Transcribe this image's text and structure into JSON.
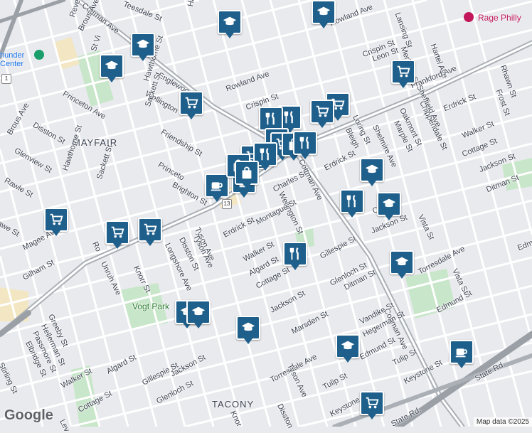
{
  "neighborhoods": {
    "mayfair": "MAYFAIR",
    "tacony": "TACONY"
  },
  "parks": {
    "vogt_park": "Vogt Park"
  },
  "places": {
    "rage_philly": "Rage Philly",
    "thunder_center_line1": "hunder",
    "thunder_center_line2": "Center"
  },
  "route_shield": "13",
  "route_shield_left": "1",
  "streets": {
    "teesdale": "Teesdale St",
    "cottman_top": "Cottman Ave",
    "hawthorne_top": "Hawthorne St",
    "revere": "Revere St",
    "brous_top": "Brous Ave",
    "st_vi": "St Vi",
    "rowland_top": "Rowland Ave",
    "crispin_top": "Crispin St",
    "lansing": "Lansing St",
    "meridian": "Meridian St",
    "hartel": "Hartel Ave",
    "leon": "Leon St",
    "englewood": "Englewood",
    "hawthorne_mid": "Hawthorne St",
    "wellington_top": "Wellington",
    "rowland_mid": "Rowland Ave",
    "crispin_mid": "Crispin St",
    "frankford": "Frankford Ave",
    "rhawn": "Rhawn St",
    "frost": "Frost St",
    "princeton_left": "Princeton Ave",
    "sackett_top": "Sackett St",
    "friendship": "Friendship St",
    "disston_left": "Disston St",
    "brous_left": "Brous Ave",
    "glenview": "Glenview St",
    "hawthorne_left": "Hawthorne St",
    "sackett_left": "Sackett St",
    "rawle": "Rawle St",
    "awe": "awe St",
    "princeton_mid": "Princeto",
    "brighton": "Brighton St",
    "charles": "Charles St",
    "wellington_mid": "Wellington St",
    "erdrick_mid": "Erdrick St",
    "cottman_mid": "Cottman Ave",
    "loring": "Loring St",
    "bleigh": "Bleigh",
    "shelmire": "Shelmire Ave",
    "oakmont": "Oakmont St",
    "marple": "Marple St",
    "chippendale": "Chippendale St",
    "sheffield": "Sheffield Ave",
    "erdrick_right": "Erdrick St",
    "walker_right": "Walker St",
    "cottage_right": "Cottage St",
    "jackson_right": "Jackson St",
    "ditman_right": "Ditman St",
    "cottage_mid": "Cottage",
    "jackson_mid": "Jackson St",
    "vista_mid": "Vista St",
    "edmun": "Edmun",
    "erdrick_low": "Erdrick St",
    "tyson": "Tyson Ave",
    "montague": "Montague St",
    "disston_mid": "Disston St",
    "longshore": "Longshore Ave",
    "walker_mid": "Walker St",
    "algard_mid": "Algard St",
    "cottage_low": "Cottage St",
    "gillespie_mid": "Gillespie St",
    "magee": "Magee Ave",
    "gilham": "Gilham St",
    "unruh": "Unruh Ave",
    "knorr_mid": "Knorr St",
    "roosevelt": "Ro",
    "jackson_low": "Jackson St",
    "glenloch_mid": "Glenloch St",
    "ditman_mid": "Ditman St",
    "torresdale_right": "Torresdale Ave",
    "vista_right": "Vista St",
    "cottman_low": "Cottman Ave",
    "greeby": "Greeby St",
    "hellerman": "Hellerman St",
    "passmore": "Passmore St",
    "elbridge": "Elbridge St",
    "stirling": "Stirling St",
    "algard_low": "Algard St",
    "walker_low": "Walker St",
    "cottage_left": "Cottage St",
    "gillespie_low": "Gillespie St",
    "jackson_left": "Jackson St",
    "glenloch_low": "Glenloch St",
    "marsden": "Marsden St",
    "torresdale_low": "Torresdale Ave",
    "tyson_low": "Tyson Ave",
    "disston_low": "Disston",
    "knorr_low": "Knor",
    "vandike": "Vandike St",
    "hegerman": "Hegerman St",
    "edmund_mid": "Edmund St",
    "edmund_right": "Edmund St",
    "tulip_mid": "Tulip St",
    "keystone_mid": "Keystone St",
    "tulip_low": "Tulip St",
    "keystone_low": "Keystone St",
    "state_rd": "State Rd.",
    "state_rd2": "State Rd.",
    "wissinoming": "Wissinoming St",
    "tyson_top": "Tyson Ave",
    "lev": "Lev"
  },
  "pins": [
    {
      "icon": "school-icon"
    },
    {
      "icon": "school-icon"
    },
    {
      "icon": "school-icon"
    },
    {
      "icon": "school-icon"
    },
    {
      "icon": "shopping-cart-icon"
    },
    {
      "icon": "shopping-cart-icon"
    },
    {
      "icon": "shopping-cart-icon"
    },
    {
      "icon": "shopping-cart-icon"
    },
    {
      "icon": "restaurant-icon"
    },
    {
      "icon": "coffee-icon"
    },
    {
      "icon": "shopping-bag-icon"
    },
    {
      "icon": "school-icon"
    },
    {
      "icon": "shopping-cart-icon"
    },
    {
      "icon": "shopping-cart-icon"
    },
    {
      "icon": "restaurant-icon"
    },
    {
      "icon": "school-icon"
    },
    {
      "icon": "restaurant-icon"
    },
    {
      "icon": "school-icon"
    },
    {
      "icon": "school-icon"
    },
    {
      "icon": "school-icon"
    },
    {
      "icon": "school-icon"
    },
    {
      "icon": "shopping-cart-icon"
    },
    {
      "icon": "coffee-icon"
    },
    {
      "icon": "shopping-cart-icon"
    },
    {
      "icon": "school-icon"
    }
  ],
  "attribution": "Map data ©2025",
  "brand": "Google",
  "colors": {
    "pin": "#1f5f8b",
    "park": "#c8e6c9",
    "highway": "#9aa0a6",
    "road": "#ffffff"
  }
}
